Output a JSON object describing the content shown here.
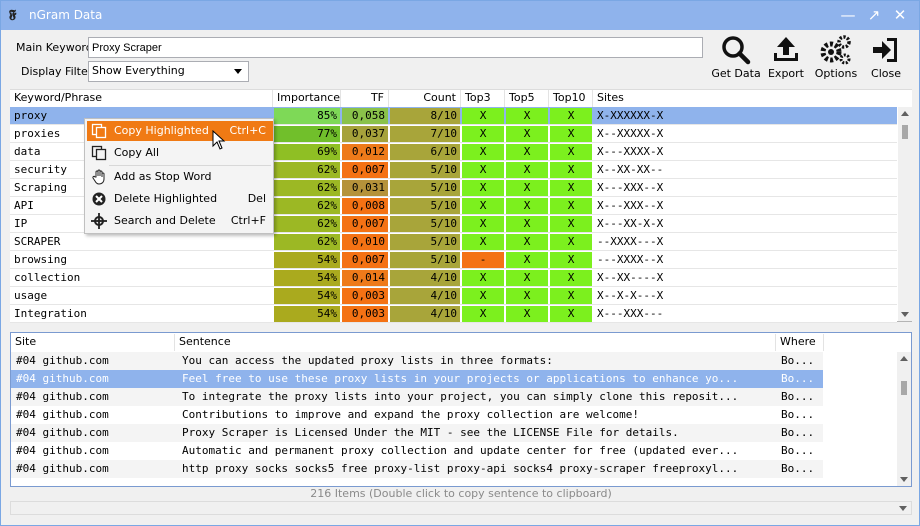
{
  "window": {
    "title": "nGram Data",
    "app_icon": "app-logo-icon"
  },
  "form": {
    "main_keyword_label": "Main Keyword",
    "main_keyword_value": "Proxy Scraper",
    "display_filter_label": "Display Filter",
    "display_filter_value": "Show Everything"
  },
  "toolbar": [
    {
      "label": "Get Data",
      "icon": "magnifier-icon"
    },
    {
      "label": "Export",
      "icon": "upload-tray-icon"
    },
    {
      "label": "Options",
      "icon": "gears-icon"
    },
    {
      "label": "Close",
      "icon": "exit-icon"
    }
  ],
  "grid": {
    "headers": [
      "Keyword/Phrase",
      "Importance",
      "TF",
      "Count",
      "Top3",
      "Top5",
      "Top10",
      "Sites"
    ],
    "rows": [
      {
        "kw": "proxy",
        "imp": "85%",
        "tf": "0,058",
        "count": "8/10",
        "t3": "X",
        "t5": "X",
        "t10": "X",
        "sites": "X-XXXXXX-X",
        "impc": "#7ed957",
        "tfc": "#8ac24a",
        "t3c": "#6dc832"
      },
      {
        "kw": "proxies",
        "imp": "77%",
        "tf": "0,037",
        "count": "7/10",
        "t3": "X",
        "t5": "X",
        "t10": "X",
        "sites": "X--XXXXX-X",
        "impc": "#71bf2b",
        "tfc": "#a6a23b",
        "t3c": "#6dc832"
      },
      {
        "kw": "data",
        "imp": "69%",
        "tf": "0,012",
        "count": "6/10",
        "t3": "X",
        "t5": "X",
        "t10": "X",
        "sites": "X---XXXX-X",
        "impc": "#8fbf24",
        "tfc": "#ee7a1a",
        "t3c": "#6dc832"
      },
      {
        "kw": "security",
        "imp": "62%",
        "tf": "0,007",
        "count": "5/10",
        "t3": "X",
        "t5": "X",
        "t10": "X",
        "sites": "X--XX-XX--",
        "impc": "#9cb824",
        "tfc": "#f47214",
        "t3c": "#6dc832"
      },
      {
        "kw": "Scraping",
        "imp": "62%",
        "tf": "0,031",
        "count": "5/10",
        "t3": "X",
        "t5": "X",
        "t10": "X",
        "sites": "X---XXX--X",
        "impc": "#9cb824",
        "tfc": "#b5923a",
        "t3c": "#6dc832"
      },
      {
        "kw": "API",
        "imp": "62%",
        "tf": "0,008",
        "count": "5/10",
        "t3": "X",
        "t5": "X",
        "t10": "X",
        "sites": "X---XXX--X",
        "impc": "#9cb824",
        "tfc": "#f47214",
        "t3c": "#6dc832"
      },
      {
        "kw": "IP",
        "imp": "62%",
        "tf": "0,007",
        "count": "5/10",
        "t3": "X",
        "t5": "X",
        "t10": "X",
        "sites": "X---XX-X-X",
        "impc": "#9cb824",
        "tfc": "#f47214",
        "t3c": "#6dc832"
      },
      {
        "kw": "SCRAPER",
        "imp": "62%",
        "tf": "0,010",
        "count": "5/10",
        "t3": "X",
        "t5": "X",
        "t10": "X",
        "sites": "--XXXX---X",
        "impc": "#9cb824",
        "tfc": "#f47214",
        "t3c": "#6dc832"
      },
      {
        "kw": "browsing",
        "imp": "54%",
        "tf": "0,007",
        "count": "5/10",
        "t3": "-",
        "t5": "X",
        "t10": "X",
        "sites": "---XXXX--X",
        "impc": "#aaaa1e",
        "tfc": "#f47214",
        "t3c": "#f47214"
      },
      {
        "kw": "collection",
        "imp": "54%",
        "tf": "0,014",
        "count": "4/10",
        "t3": "X",
        "t5": "X",
        "t10": "X",
        "sites": "X--XX----X",
        "impc": "#aaaa1e",
        "tfc": "#ee7a1a",
        "t3c": "#6dc832"
      },
      {
        "kw": "usage",
        "imp": "54%",
        "tf": "0,003",
        "count": "4/10",
        "t3": "X",
        "t5": "X",
        "t10": "X",
        "sites": "X--X-X---X",
        "impc": "#aaaa1e",
        "tfc": "#f47214",
        "t3c": "#6dc832"
      },
      {
        "kw": "Integration",
        "imp": "54%",
        "tf": "0,003",
        "count": "4/10",
        "t3": "X",
        "t5": "X",
        "t10": "X",
        "sites": "X---XXX---",
        "impc": "#aaaa1e",
        "tfc": "#f47214",
        "t3c": "#6dc832"
      }
    ]
  },
  "context_menu": [
    {
      "label": "Copy Highlighted",
      "shortcut": "Ctrl+C",
      "icon": "copy-icon"
    },
    {
      "label": "Copy All",
      "shortcut": "",
      "icon": "copy-all-icon"
    },
    {
      "label": "Add as Stop Word",
      "shortcut": "",
      "icon": "hand-icon"
    },
    {
      "label": "Delete Highlighted",
      "shortcut": "Del",
      "icon": "delete-icon"
    },
    {
      "label": "Search and Delete",
      "shortcut": "Ctrl+F",
      "icon": "crosshair-icon"
    }
  ],
  "sentences": {
    "headers": [
      "Site",
      "Sentence",
      "Where"
    ],
    "rows": [
      {
        "site": "#04 github.com",
        "sentence": "You can access the updated proxy lists in three formats:",
        "where": "Bo..."
      },
      {
        "site": "#04 github.com",
        "sentence": "Feel free to use these proxy lists in your projects or applications to enhance yo...",
        "where": "Bo..."
      },
      {
        "site": "#04 github.com",
        "sentence": "To integrate the proxy lists into your project, you can simply clone this reposit...",
        "where": "Bo..."
      },
      {
        "site": "#04 github.com",
        "sentence": "Contributions to improve and expand the proxy collection are welcome!",
        "where": "Bo..."
      },
      {
        "site": "#04 github.com",
        "sentence": "Proxy Scraper is Licensed Under the MIT - see the LICENSE File for details.",
        "where": "Bo..."
      },
      {
        "site": "#04 github.com",
        "sentence": "Automatic and permanent proxy collection and update center for free (updated ever...",
        "where": "Bo..."
      },
      {
        "site": "#04 github.com",
        "sentence": "http proxy socks socks5 free proxy-list proxy-api socks4 proxy-scraper freeproxyl...",
        "where": "Bo..."
      }
    ]
  },
  "status": "216 Items (Double click to copy sentence to clipboard)",
  "colors": {
    "titlebar": "#8fb3ec",
    "selection": "#8fb3ec",
    "menu_highlight": "#f07a14",
    "count_cell": "#a8a53a",
    "x_cell": "#7cf01e"
  }
}
